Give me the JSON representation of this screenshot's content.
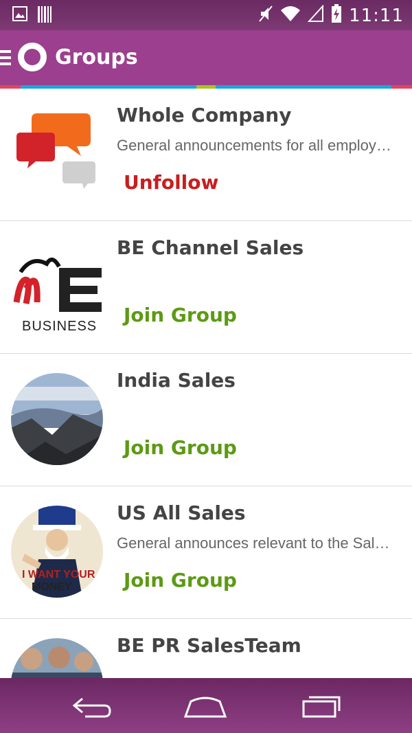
{
  "status_bar": {
    "time": "11:11",
    "icons": [
      "image-icon",
      "barcode-icon",
      "mute-icon",
      "wifi-icon",
      "signal-icon",
      "battery-charging-icon"
    ]
  },
  "app_bar": {
    "title": "Groups",
    "icons": [
      "menu-icon",
      "app-logo-icon"
    ]
  },
  "colors": {
    "app_bar": "#9b3f8e",
    "status_bar": "#6a2a62",
    "unfollow": "#c81e1e",
    "join": "#5c9a14",
    "stripe": [
      "#e2455b",
      "#18a7e0",
      "#a7c61b",
      "#18a7e0",
      "#e2455b"
    ]
  },
  "groups": [
    {
      "name": "Whole Company",
      "description": "General announcements for all employ…",
      "action": "Unfollow",
      "thumb": "speech-bubbles-icon"
    },
    {
      "name": "BE Channel Sales",
      "description": "",
      "action": "Join Group",
      "thumb": "be-business-logo"
    },
    {
      "name": "India Sales",
      "description": "",
      "action": "Join Group",
      "thumb": "mountain-photo"
    },
    {
      "name": "US All Sales",
      "description": "General announces relevant to the Sal…",
      "action": "Join Group",
      "thumb": "uncle-sam-poster"
    },
    {
      "name": "BE PR SalesTeam",
      "description": "",
      "action": "",
      "thumb": "team-photo"
    }
  ],
  "thumb_texts": {
    "be_business": "BUSINESS",
    "uncle_sam_line1": "I WANT YOUR",
    "uncle_sam_line2": "MONEY"
  },
  "nav_bar": {
    "icons": [
      "back-icon",
      "home-icon",
      "recent-apps-icon"
    ]
  }
}
